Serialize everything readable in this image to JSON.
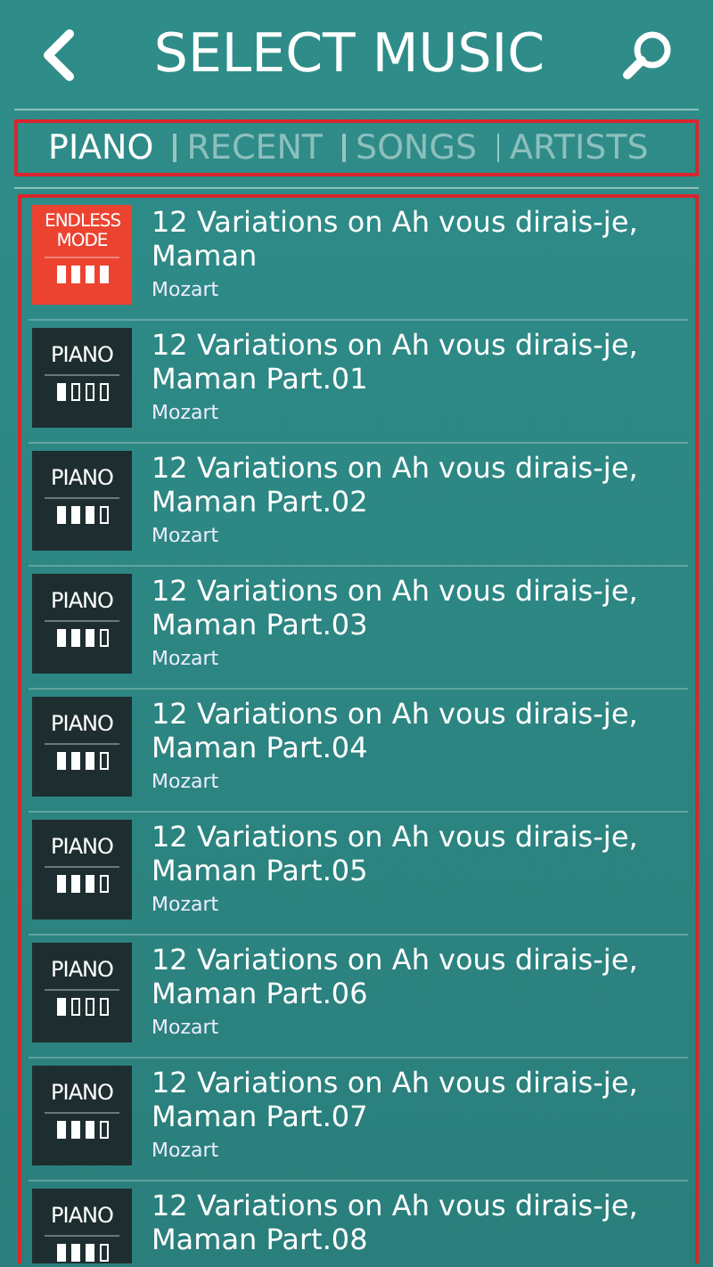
{
  "header": {
    "title": "SELECT MUSIC"
  },
  "tabs_highlighted": true,
  "tabs": [
    {
      "label": "PIANO",
      "selected": true
    },
    {
      "label": "RECENT",
      "selected": false
    },
    {
      "label": "SONGS",
      "selected": false
    },
    {
      "label": "ARTISTS",
      "selected": false
    }
  ],
  "list_highlighted": true,
  "songs": [
    {
      "kind": "endless",
      "badge": "ENDLESS MODE",
      "level": 1,
      "title": "12 Variations on Ah vous dirais-je, Maman",
      "artist": "Mozart"
    },
    {
      "kind": "piano",
      "badge": "PIANO",
      "level": 0.25,
      "title": "12 Variations on Ah vous dirais-je, Maman Part.01",
      "artist": "Mozart"
    },
    {
      "kind": "piano",
      "badge": "PIANO",
      "level": 0.75,
      "title": "12 Variations on Ah vous dirais-je, Maman Part.02",
      "artist": "Mozart"
    },
    {
      "kind": "piano",
      "badge": "PIANO",
      "level": 0.75,
      "title": "12 Variations on Ah vous dirais-je, Maman Part.03",
      "artist": "Mozart"
    },
    {
      "kind": "piano",
      "badge": "PIANO",
      "level": 0.75,
      "title": "12 Variations on Ah vous dirais-je, Maman Part.04",
      "artist": "Mozart"
    },
    {
      "kind": "piano",
      "badge": "PIANO",
      "level": 0.75,
      "title": "12 Variations on Ah vous dirais-je, Maman Part.05",
      "artist": "Mozart"
    },
    {
      "kind": "piano",
      "badge": "PIANO",
      "level": 0.25,
      "title": "12 Variations on Ah vous dirais-je, Maman Part.06",
      "artist": "Mozart"
    },
    {
      "kind": "piano",
      "badge": "PIANO",
      "level": 0.75,
      "title": "12 Variations on Ah vous dirais-je, Maman Part.07",
      "artist": "Mozart"
    },
    {
      "kind": "piano",
      "badge": "PIANO",
      "level": 0.75,
      "title": "12 Variations on Ah vous dirais-je, Maman Part.08"
    }
  ]
}
